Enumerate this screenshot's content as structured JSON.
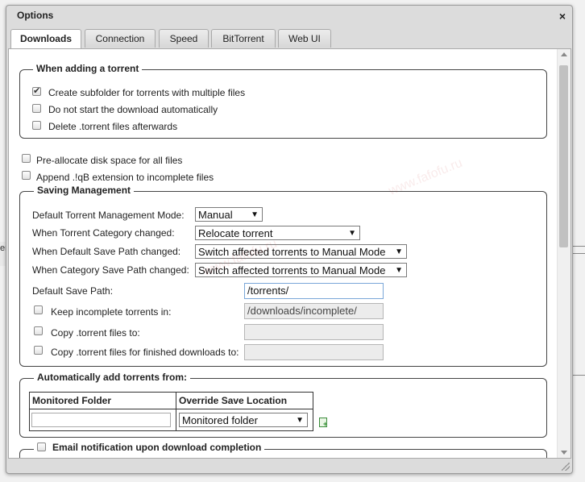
{
  "window": {
    "title": "Options",
    "close_symbol": "×"
  },
  "background": {
    "edge_text": "er"
  },
  "tabs": [
    {
      "label": "Downloads"
    },
    {
      "label": "Connection"
    },
    {
      "label": "Speed"
    },
    {
      "label": "BitTorrent"
    },
    {
      "label": "Web UI"
    }
  ],
  "adding": {
    "legend": "When adding a torrent",
    "opt1": {
      "label": "Create subfolder for torrents with multiple files",
      "checked": true
    },
    "opt2": {
      "label": "Do not start the download automatically",
      "checked": false
    },
    "opt3": {
      "label": "Delete .torrent files afterwards",
      "checked": false
    }
  },
  "prealloc": {
    "label": "Pre-allocate disk space for all files",
    "checked": false
  },
  "append": {
    "label": "Append .!qB extension to incomplete files",
    "checked": false
  },
  "saving": {
    "legend": "Saving Management",
    "mode_label": "Default Torrent Management Mode:",
    "mode_value": "Manual",
    "cat_changed_label": "When Torrent Category changed:",
    "cat_changed_value": "Relocate torrent",
    "def_path_changed_label": "When Default Save Path changed:",
    "def_path_changed_value": "Switch affected torrents to Manual Mode",
    "cat_path_changed_label": "When Category Save Path changed:",
    "cat_path_changed_value": "Switch affected torrents to Manual Mode",
    "save_path_label": "Default Save Path:",
    "save_path_value": "/torrents/",
    "incomplete_label": "Keep incomplete torrents in:",
    "incomplete_value": "/downloads/incomplete/",
    "copy_label": "Copy .torrent files to:",
    "copy_value": "",
    "copy_finished_label": "Copy .torrent files for finished downloads to:",
    "copy_finished_value": ""
  },
  "auto_add": {
    "legend": "Automatically add torrents from:",
    "col_folder": "Monitored Folder",
    "col_override": "Override Save Location",
    "override_value": "Monitored folder"
  },
  "email": {
    "label": "Email notification upon download completion",
    "checked": false
  },
  "icons": {
    "close": "close-icon",
    "check": "checkmark-icon",
    "caret": "caret-down-icon",
    "add": "add-folder-icon"
  },
  "watermark": {
    "text": "www.fafofu.ru"
  },
  "colors": {
    "panel_bg": "#ffffff",
    "window_bg": "#dcdcdc",
    "border": "#444444",
    "focus": "#7aa7d8"
  }
}
